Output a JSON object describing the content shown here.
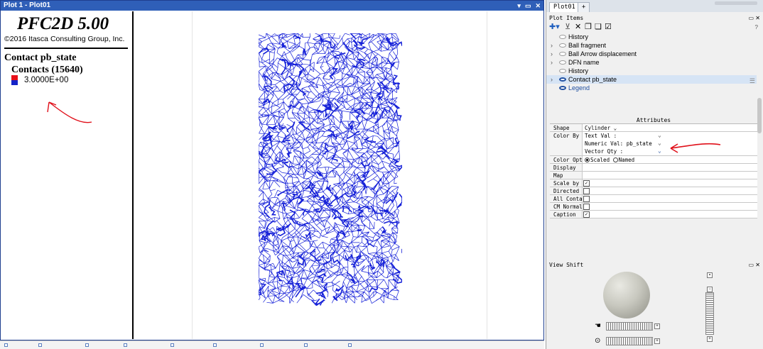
{
  "plot_window": {
    "title": "Plot 1 - Plot01",
    "controls": [
      "▾",
      "▭",
      "✕"
    ]
  },
  "legend": {
    "app_name": "PFC2D 5.00",
    "copyright": "©2016 Itasca Consulting Group, Inc.",
    "title": "Contact pb_state",
    "subtitle": "Contacts (15640)",
    "value": "3.0000E+00",
    "swatch_colors": [
      "#e8101a",
      "#1423c8"
    ]
  },
  "plot": {
    "network_color": "#1520d8"
  },
  "right_pane": {
    "tabs": [
      "Plot01",
      "+"
    ],
    "plot_items_title": "Plot Items",
    "panel_controls": "▭ ✕",
    "toolbar_icons": [
      "add-icon",
      "filter-icon",
      "delete-icon",
      "copy-icon",
      "paste-icon",
      "checkbox-icon"
    ],
    "toolbar_glyphs": [
      "✚▾",
      "⊻",
      "✕",
      "❐",
      "❏",
      "☑"
    ],
    "help": "?",
    "items": [
      {
        "label": "History",
        "expandable": false,
        "visible": false,
        "selected": false
      },
      {
        "label": "Ball fragment",
        "expandable": true,
        "visible": false,
        "selected": false
      },
      {
        "label": "Ball Arrow displacement",
        "expandable": true,
        "visible": false,
        "selected": false
      },
      {
        "label": "DFN name",
        "expandable": true,
        "visible": false,
        "selected": false
      },
      {
        "label": "History",
        "expandable": false,
        "visible": false,
        "selected": false
      },
      {
        "label": "Contact pb_state",
        "expandable": true,
        "visible": true,
        "selected": true
      },
      {
        "label": "Legend",
        "expandable": false,
        "visible": true,
        "selected": false
      }
    ],
    "attributes_title": "Attributes",
    "attributes": {
      "shape_key": "Shape",
      "shape_value": "Cylinder",
      "color_by_key": "Color By",
      "text_val": "Text Val  :",
      "numeric_val": "Numeric Val:  pb_state",
      "vector_qty": "Vector Qty :",
      "color_opt_key": "Color Opt",
      "scaled": "Scaled",
      "named": "Named",
      "display_key": "Display",
      "map_key": "Map",
      "scale_key": "Scale by F",
      "directed_key": "Directed",
      "all_contacts_key": "All Contac",
      "cm_normal_key": "CM Normal",
      "caption_key": "Caption",
      "checks": {
        "scale": true,
        "directed": false,
        "all_contacts": false,
        "cm_normal": false,
        "caption": true
      }
    },
    "view_shift_title": "View Shift"
  },
  "annotation_color": "#e0101a"
}
